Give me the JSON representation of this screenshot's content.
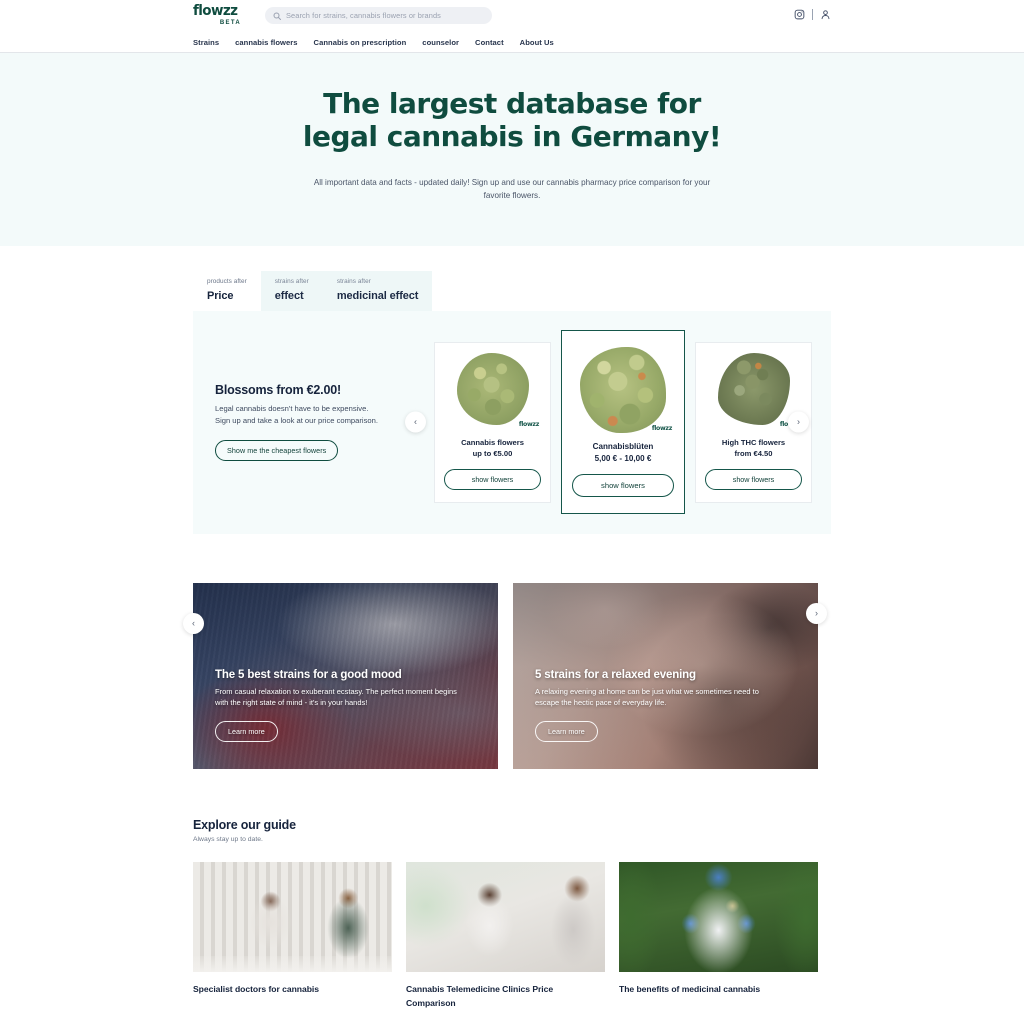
{
  "header": {
    "logo_main": "flowzz",
    "logo_beta": "BETA",
    "search": {
      "placeholder": "Search for strains, cannabis flowers or brands",
      "value": ""
    },
    "nav": [
      {
        "label": "Strains"
      },
      {
        "label": "cannabis flowers"
      },
      {
        "label": "Cannabis on prescription"
      },
      {
        "label": "counselor"
      },
      {
        "label": "Contact"
      },
      {
        "label": "About Us"
      }
    ],
    "instagram_icon": "instagram-icon",
    "account_icon": "user-account-icon"
  },
  "hero": {
    "title": "The largest database for legal cannabis in Germany!",
    "subtitle": "All important data and facts - updated daily! Sign up and use our cannabis pharmacy price comparison for your favorite flowers."
  },
  "products": {
    "tabs": [
      {
        "sub": "products after",
        "title": "Price",
        "active": true
      },
      {
        "sub": "strains after",
        "title": "effect",
        "active": false
      },
      {
        "sub": "strains after",
        "title": "medicinal effect",
        "active": false
      }
    ],
    "promo": {
      "heading": "Blossoms from €2.00!",
      "line1": "Legal cannabis doesn't have to be expensive.",
      "line2": "Sign up and take a look at our price comparison.",
      "button": "Show me the cheapest flowers"
    },
    "cards": [
      {
        "name": "Cannabis flowers",
        "price": "up to €5.00",
        "button": "show flowers",
        "brand": "flowzz",
        "featured": false
      },
      {
        "name": "Cannabisblüten",
        "price": "5,00 € - 10,00 €",
        "button": "show flowers",
        "brand": "flowzz",
        "featured": true
      },
      {
        "name": "High THC flowers",
        "price": "from €4.50",
        "button": "show flowers",
        "brand": "flowzz",
        "featured": false
      }
    ],
    "prev_arrow": "chevron-left-icon",
    "next_arrow": "chevron-right-icon"
  },
  "banners": [
    {
      "title": "The 5 best strains for a good mood",
      "text": "From casual relaxation to exuberant ecstasy. The perfect moment begins with the right state of mind - it's in your hands!",
      "button": "Learn more"
    },
    {
      "title": "5 strains for a relaxed evening",
      "text": "A relaxing evening at home can be just what we sometimes need to escape the hectic pace of everyday life.",
      "button": "Learn more"
    }
  ],
  "guide": {
    "heading": "Explore our guide",
    "subheading": "Always stay up to date.",
    "cards": [
      {
        "title": "Specialist doctors for cannabis"
      },
      {
        "title": "Cannabis Telemedicine Clinics Price Comparison"
      },
      {
        "title": "The benefits of medicinal cannabis"
      }
    ]
  },
  "colors": {
    "brand_green": "#0f4c3f",
    "hero_bg": "#f3fafa",
    "panel_bg": "#f5fbfb",
    "text_dark": "#16233c"
  }
}
